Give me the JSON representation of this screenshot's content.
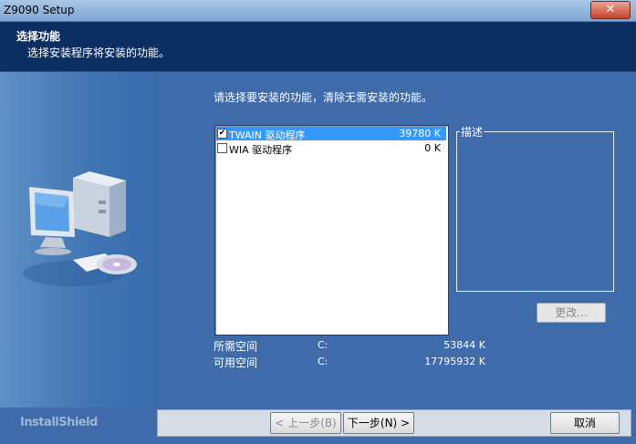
{
  "window": {
    "title": "Z9090 Setup",
    "close_symbol": "✕"
  },
  "header": {
    "title": "选择功能",
    "subtitle": "选择安装程序将安装的功能。"
  },
  "instruction": "请选择要安装的功能，清除无需安装的功能。",
  "features": [
    {
      "name": "TWAIN 驱动程序",
      "size": "39780 K",
      "checked": true,
      "selected": true
    },
    {
      "name": "WIA 驱动程序",
      "size": "0 K",
      "checked": false,
      "selected": false
    }
  ],
  "description": {
    "label": "描述"
  },
  "change_button": "更改...",
  "space": {
    "required_label": "所需空间",
    "required_drive": "C:",
    "required_value": "53844 K",
    "available_label": "可用空间",
    "available_drive": "C:",
    "available_value": "17795932 K"
  },
  "footer": {
    "brand": "InstallShield",
    "back_button": "< 上一步(B)",
    "next_button": "下一步(N) >",
    "cancel_button": "取消"
  }
}
